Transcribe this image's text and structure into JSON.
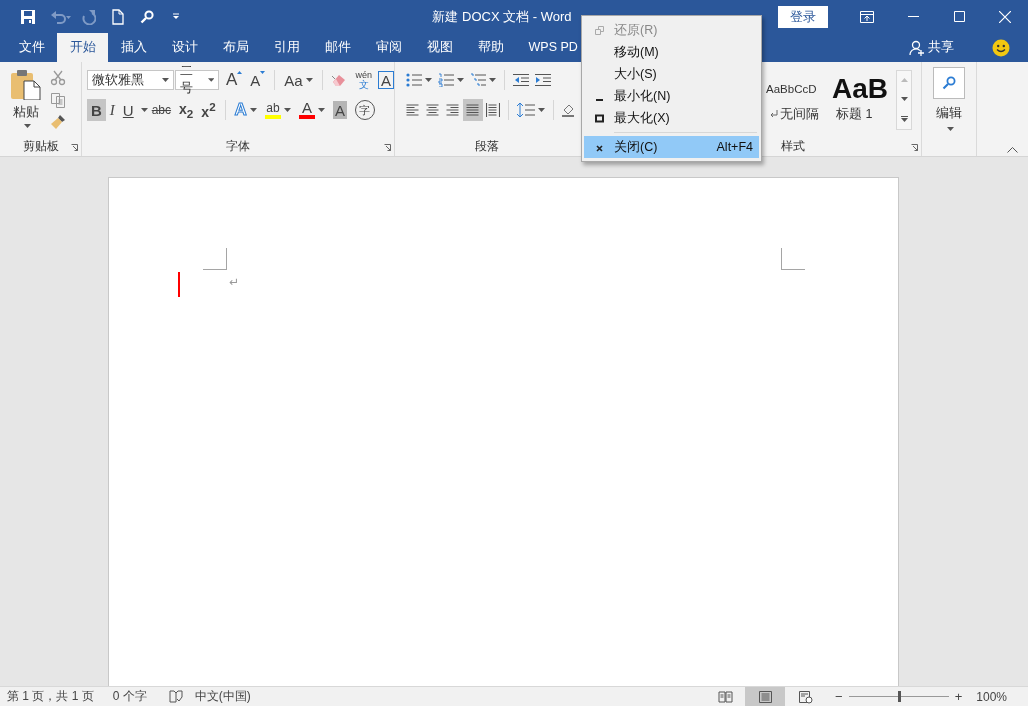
{
  "window": {
    "title": "新建 DOCX 文档  -  Word",
    "login": "登录"
  },
  "tabs": [
    {
      "label": "文件",
      "selected": false
    },
    {
      "label": "开始",
      "selected": true
    },
    {
      "label": "插入",
      "selected": false
    },
    {
      "label": "设计",
      "selected": false
    },
    {
      "label": "布局",
      "selected": false
    },
    {
      "label": "引用",
      "selected": false
    },
    {
      "label": "邮件",
      "selected": false
    },
    {
      "label": "审阅",
      "selected": false
    },
    {
      "label": "视图",
      "selected": false
    },
    {
      "label": "帮助",
      "selected": false
    },
    {
      "label": "WPS PD",
      "selected": false
    }
  ],
  "account": {
    "share": "共享"
  },
  "ribbon": {
    "clipboard": {
      "paste": "粘贴",
      "label": "剪贴板"
    },
    "font": {
      "label": "字体",
      "font_name": "微软雅黑",
      "font_size": "二号",
      "row1": [
        {
          "kind": "grow",
          "label": "A"
        },
        {
          "kind": "shrink",
          "label": "A"
        },
        {
          "kind": "case",
          "label": "Aa"
        },
        {
          "kind": "clear"
        },
        {
          "kind": "phonetic",
          "label": "wén",
          "sub": "文"
        },
        {
          "kind": "border",
          "label": "A"
        }
      ],
      "row2": [
        {
          "kind": "bold",
          "label": "B",
          "selected": true
        },
        {
          "kind": "italic",
          "label": "I",
          "selected": false
        },
        {
          "kind": "underline",
          "label": "U",
          "selected": false
        },
        {
          "kind": "strike",
          "label": "abc",
          "selected": false
        },
        {
          "kind": "subscript",
          "label": "x$_{2}$",
          "selected": false
        },
        {
          "kind": "superscript",
          "label": "x$^{2}$",
          "selected": false
        },
        {
          "kind": "effects",
          "label": "A"
        },
        {
          "kind": "highlight",
          "label": "ab",
          "color": "#ffff00"
        },
        {
          "kind": "color",
          "label": "A",
          "color": "#ff0000"
        },
        {
          "kind": "shading",
          "label": "A"
        },
        {
          "kind": "enclose",
          "label": "字"
        }
      ]
    },
    "paragraph": {
      "label": "段落",
      "aligns": [
        {
          "kind": "left",
          "selected": false
        },
        {
          "kind": "center",
          "selected": false
        },
        {
          "kind": "right",
          "selected": false
        },
        {
          "kind": "justify",
          "selected": true
        },
        {
          "kind": "distributed",
          "selected": false
        }
      ]
    },
    "styles": {
      "label": "样式",
      "items": [
        {
          "kind": "nospacing",
          "sample": "AaBbCcD",
          "name": "无间隔"
        },
        {
          "kind": "heading",
          "sample": "AaB",
          "name": "标题 1"
        }
      ]
    },
    "editing": {
      "label": "编辑"
    }
  },
  "document": {
    "paragraph_mark": "↵"
  },
  "system_menu": {
    "items": [
      {
        "kind": "restore",
        "label": "还原(R)",
        "disabled": true,
        "selected": false
      },
      {
        "kind": "move",
        "label": "移动(M)",
        "disabled": false,
        "selected": false
      },
      {
        "kind": "size",
        "label": "大小(S)",
        "disabled": false,
        "selected": false
      },
      {
        "kind": "minimize",
        "label": "最小化(N)",
        "disabled": false,
        "selected": false
      },
      {
        "kind": "maximize",
        "label": "最大化(X)",
        "disabled": false,
        "selected": false
      },
      {
        "kind": "close",
        "label": "关闭(C)",
        "shortcut": "Alt+F4",
        "disabled": false,
        "selected": true
      }
    ]
  },
  "status_bar": {
    "page": "第 1 页，共 1 页",
    "words": "0 个字",
    "language": "中文(中国)",
    "views": [
      {
        "kind": "read",
        "selected": false
      },
      {
        "kind": "print",
        "selected": true
      },
      {
        "kind": "web",
        "selected": false
      }
    ],
    "zoom_out": "−",
    "zoom_in": "+",
    "zoom": {
      "level": 0.5,
      "reading": "100%"
    }
  }
}
